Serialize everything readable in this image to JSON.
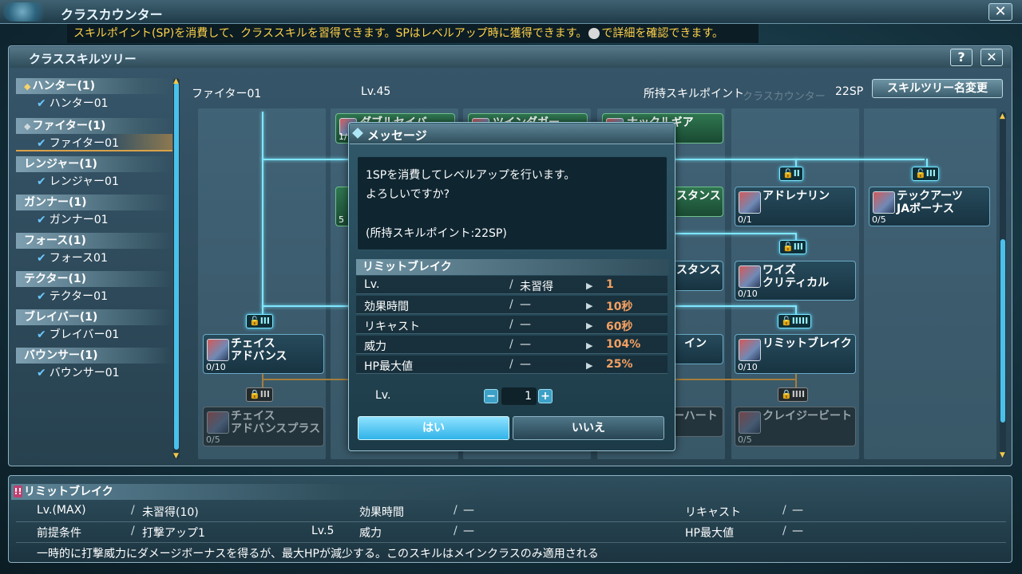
{
  "window": {
    "title": "クラスカウンター",
    "close_label": "✕"
  },
  "info_bar": {
    "text_before": "スキルポイント(SP)を消費して、クラススキルを習得できます。SPはレベルアップ時に獲得できます。",
    "text_after": "で詳細を確認できます。"
  },
  "tree_panel": {
    "title": "クラススキルツリー",
    "help_label": "?",
    "close_label": "✕"
  },
  "classes": [
    {
      "name": "ハンター(1)",
      "tree": "ハンター01"
    },
    {
      "name": "ファイター(1)",
      "tree": "ファイター01"
    },
    {
      "name": "レンジャー(1)",
      "tree": "レンジャー01"
    },
    {
      "name": "ガンナー(1)",
      "tree": "ガンナー01"
    },
    {
      "name": "フォース(1)",
      "tree": "フォース01"
    },
    {
      "name": "テクター(1)",
      "tree": "テクター01"
    },
    {
      "name": "ブレイバー(1)",
      "tree": "ブレイバー01"
    },
    {
      "name": "バウンサー(1)",
      "tree": "バウンサー01"
    }
  ],
  "tree_info": {
    "tree_name": "ファイター01",
    "level": "Lv.45",
    "sp_label": "所持スキルポイント",
    "sp_value": "22SP",
    "rename_button": "スキルツリー名変更",
    "ghost_text": "クラスカウンター"
  },
  "skills": {
    "chase_advance": {
      "name1": "チェイス",
      "name2": "アドバンス",
      "lv": "0/10"
    },
    "chase_advance_plus": {
      "name1": "チェイス",
      "name2": "アドバンスプラス",
      "lv": "0/5"
    },
    "adrenaline": {
      "name1": "アドレナリン",
      "name2": "",
      "lv": "0/1"
    },
    "tech_arts": {
      "name1": "テックアーツ",
      "name2": "JAボーナス",
      "lv": "0/5"
    },
    "wise_critical": {
      "name1": "ワイズ",
      "name2": "クリティカル",
      "lv": "0/10"
    },
    "limit_break": {
      "name1": "リミットブレイク",
      "name2": "",
      "lv": "0/10"
    },
    "crazy_beat": {
      "name1": "クレイジービート",
      "name2": "",
      "lv": "0/5"
    },
    "peek_top1": {
      "name1": "ダブルセイバ",
      "name2": "",
      "lv": "1/"
    },
    "peek_top2": {
      "name1": "ツインダガー",
      "name2": "",
      "lv": ""
    },
    "peek_top3": {
      "name1": "ナックルギア",
      "name2": "",
      "lv": ""
    },
    "peek_stance": {
      "name1": "スタンス",
      "name2": "",
      "lv": ""
    },
    "peek_wise_stance": {
      "name1": "スタンス",
      "name2": "",
      "lv": ""
    },
    "peek_line": {
      "name1": "イン",
      "name2": "",
      "lv": ""
    },
    "peek_heart": {
      "name1": "ーハート",
      "name2": "",
      "lv": ""
    },
    "peek_5": {
      "name1": "",
      "name2": "",
      "lv": "5"
    }
  },
  "badges": {
    "b_ii": "II",
    "b_iii_top": "III",
    "b_iii_mid": "III",
    "b_iiiii": "IIIII",
    "b_iii_left": "III",
    "b_iii_gold_left": "III",
    "b_iiii_gold": "IIII"
  },
  "dialog": {
    "title": "メッセージ",
    "line1": "1SPを消費してレベルアップを行います。",
    "line2": "よろしいですか?",
    "line3": "(所持スキルポイント:22SP)",
    "skill_name": "リミットブレイク",
    "rows": [
      {
        "label": "Lv.",
        "current": "未習得",
        "next": "1"
      },
      {
        "label": "効果時間",
        "current": "—",
        "next": "10秒"
      },
      {
        "label": "リキャスト",
        "current": "—",
        "next": "60秒"
      },
      {
        "label": "威力",
        "current": "—",
        "next": "104%"
      },
      {
        "label": "HP最大値",
        "current": "—",
        "next": "25%"
      }
    ],
    "lv_label": "Lv.",
    "lv_value": "1",
    "minus": "−",
    "plus": "+",
    "yes": "はい",
    "no": "いいえ"
  },
  "detail": {
    "mark": "!!",
    "title": "リミットブレイク",
    "lv_max_label": "Lv.(MAX)",
    "lv_max_value": "未習得(10)",
    "duration_label": "効果時間",
    "duration_value": "—",
    "recast_label": "リキャスト",
    "recast_value": "—",
    "prereq_label": "前提条件",
    "prereq_value": "打撃アップ1",
    "prereq_lv": "Lv.5",
    "power_label": "威力",
    "power_value": "—",
    "hp_label": "HP最大値",
    "hp_value": "—",
    "description": "一時的に打撃威力にダメージボーナスを得るが、最大HPが減少する。このスキルはメインクラスのみ適用される"
  },
  "colors": {
    "accent": "#4ac1ea",
    "next_value": "#f4a062",
    "notice": "#ffd24a"
  }
}
